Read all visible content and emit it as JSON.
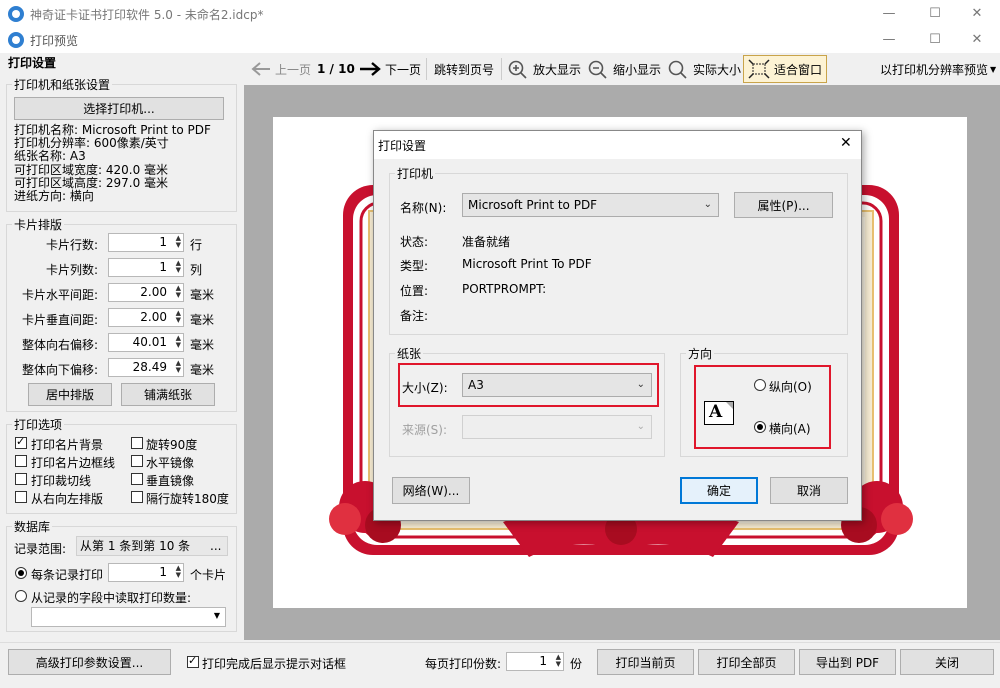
{
  "main_window": {
    "title": "神奇证卡证书打印软件 5.0 - 未命名2.idcp*"
  },
  "preview_window": {
    "title": "打印预览"
  },
  "left_panel": {
    "heading": "打印设置",
    "printer_group": {
      "legend": "打印机和纸张设置",
      "select_button": "选择打印机...",
      "info": [
        "打印机名称: Microsoft Print to PDF",
        "打印机分辨率: 600像素/英寸",
        "纸张名称: A3",
        "可打印区域宽度: 420.0 毫米",
        "可打印区域高度: 297.0 毫米",
        "进纸方向: 横向"
      ]
    },
    "layout_group": {
      "legend": "卡片排版",
      "rows": [
        {
          "label": "卡片行数:",
          "value": "1",
          "unit": "行"
        },
        {
          "label": "卡片列数:",
          "value": "1",
          "unit": "列"
        },
        {
          "label": "卡片水平间距:",
          "value": "2.00",
          "unit": "毫米"
        },
        {
          "label": "卡片垂直间距:",
          "value": "2.00",
          "unit": "毫米"
        },
        {
          "label": "整体向右偏移:",
          "value": "40.01",
          "unit": "毫米"
        },
        {
          "label": "整体向下偏移:",
          "value": "28.49",
          "unit": "毫米"
        }
      ],
      "center_button": "居中排版",
      "fill_button": "铺满纸张"
    },
    "options_group": {
      "legend": "打印选项",
      "options": [
        {
          "label": "打印名片背景",
          "checked": true
        },
        {
          "label": "旋转90度",
          "checked": false
        },
        {
          "label": "打印名片边框线",
          "checked": false
        },
        {
          "label": "水平镜像",
          "checked": false
        },
        {
          "label": "打印裁切线",
          "checked": false
        },
        {
          "label": "垂直镜像",
          "checked": false
        },
        {
          "label": "从右向左排版",
          "checked": false
        },
        {
          "label": "隔行旋转180度",
          "checked": false
        }
      ]
    },
    "database_group": {
      "legend": "数据库",
      "range_label": "记录范围:",
      "range_value": "从第 1 条到第 10 条",
      "range_button": "...",
      "per_record_label": "每条记录打印",
      "per_record_value": "1",
      "per_record_unit": "个卡片",
      "from_field_label": "从记录的字段中读取打印数量:",
      "field_select_value": ""
    }
  },
  "toolbar": {
    "prev": "上一页",
    "page_indicator": "1 / 10",
    "next": "下一页",
    "jump": "跳转到页号",
    "zoom_in": "放大显示",
    "zoom_out": "缩小显示",
    "actual_size": "实际大小",
    "fit_window": "适合窗口",
    "resolution_mode": "以打印机分辨率预览"
  },
  "dialog": {
    "title": "打印设置",
    "printer_legend": "打印机",
    "name_label": "名称(N):",
    "name_value": "Microsoft Print to PDF",
    "properties_button": "属性(P)...",
    "status_label": "状态:",
    "status_value": "准备就绪",
    "type_label": "类型:",
    "type_value": "Microsoft Print To PDF",
    "where_label": "位置:",
    "where_value": "PORTPROMPT:",
    "comment_label": "备注:",
    "comment_value": "",
    "paper_legend": "纸张",
    "size_label": "大小(Z):",
    "size_value": "A3",
    "source_label": "来源(S):",
    "source_value": "",
    "orientation_legend": "方向",
    "portrait_label": "纵向(O)",
    "landscape_label": "横向(A)",
    "orientation_selected": "landscape",
    "network_button": "网络(W)...",
    "ok_button": "确定",
    "cancel_button": "取消"
  },
  "bottom": {
    "advanced_button": "高级打印参数设置...",
    "show_dialog_label": "打印完成后显示提示对话框",
    "show_dialog_checked": true,
    "copies_label": "每页打印份数:",
    "copies_value": "1",
    "copies_unit": "份",
    "print_current": "打印当前页",
    "print_all": "打印全部页",
    "export_pdf": "导出到 PDF",
    "close": "关闭"
  },
  "colors": {
    "highlight": "#e0162b",
    "certificate_red": "#c8102e",
    "certificate_gold": "#e8c070"
  }
}
